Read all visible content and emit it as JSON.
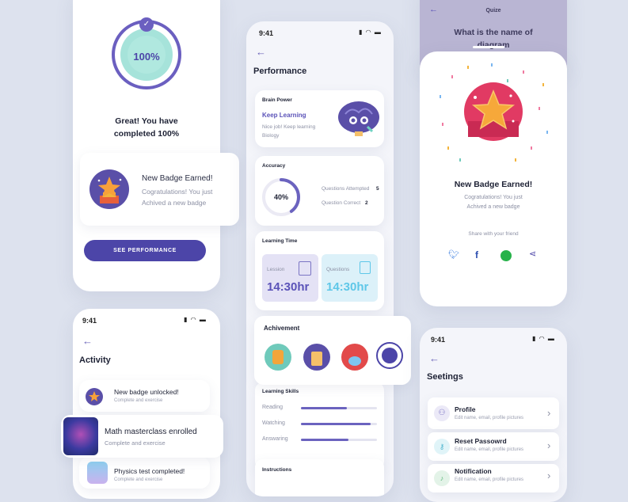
{
  "completion": {
    "progress_label": "100%",
    "progress_value": 1.0,
    "message": "Great! You have completed 100%",
    "badge_card": {
      "title": "New Badge Earned!",
      "text": "Cogratulations! You just Achived a new badge"
    },
    "button": "SEE PERFORMANCE"
  },
  "activity": {
    "time": "9:41",
    "title": "Activity",
    "items": [
      {
        "title": "New badge unlocked!",
        "sub": "Complete and exercise"
      },
      {
        "title": "Math masterclass enrolled",
        "sub": "Complete and exercise"
      },
      {
        "title": "Physics test completed!",
        "sub": "Complete and exercise"
      }
    ]
  },
  "performance": {
    "time": "9:41",
    "title": "Performance",
    "brain": {
      "heading": "Brain Power",
      "title": "Keep Learning",
      "text": "Nice job! Keep learning Biology"
    },
    "accuracy": {
      "heading": "Accuracy",
      "percent_label": "40%",
      "percent_value": 0.4,
      "attempted_label": "Questions Attempted",
      "attempted_value": "5",
      "correct_label": "Question Correct",
      "correct_value": "2"
    },
    "learning_time": {
      "heading": "Learning Time",
      "lesson_label": "Lession",
      "lesson_value": "14:30hr",
      "questions_label": "Questions",
      "questions_value": "14:30hr"
    },
    "achievement": {
      "heading": "Achivement"
    },
    "skills": {
      "heading": "Learning Skills",
      "items": [
        {
          "name": "Reading",
          "value": 0.6
        },
        {
          "name": "Watching",
          "value": 0.92
        },
        {
          "name": "Answaring",
          "value": 0.62
        }
      ]
    },
    "instructions": {
      "heading": "Instructions"
    }
  },
  "quiz": {
    "header": "Quize",
    "question": "What is the name of diagram"
  },
  "badge_modal": {
    "title": "New Badge Earned!",
    "text_line1": "Cogratulations! You just",
    "text_line2": "Achived a new badge",
    "share_label": "Share with your friend"
  },
  "settings": {
    "time": "9:41",
    "title": "Seetings",
    "items": [
      {
        "title": "Profile",
        "sub": "Edit name, email, profile pictures"
      },
      {
        "title": "Reset Passowrd",
        "sub": "Edit name, email, profile pictures"
      },
      {
        "title": "Notification",
        "sub": "Edit name, email, profile pictures"
      }
    ]
  },
  "colors": {
    "accent": "#4c45a8",
    "progress_ring": "#6b5fc0",
    "teal": "#8fdad0",
    "lesson_bg": "#e4e2f5",
    "questions_bg": "#dcf1f9",
    "questions_text": "#5ec7e8"
  }
}
